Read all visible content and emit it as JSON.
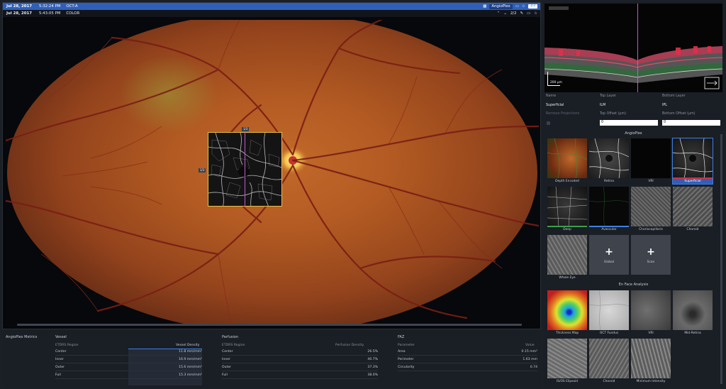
{
  "header_top": {
    "date": "Jul 28, 2017",
    "time": "5:32:24 PM",
    "modality": "OCT-A",
    "angioplex_label": "AngioPlex",
    "counter": "1/3"
  },
  "header_second": {
    "date": "Jul 28, 2017",
    "time": "5:43:05 PM",
    "mode": "COLOR",
    "page": "2/2"
  },
  "fundus": {
    "octa_tag_top": "1/3",
    "octa_tag_left": "1/3"
  },
  "metrics": {
    "section_title": "AngioPlex Metrics",
    "vessel": {
      "title": "Vessel",
      "col1": "ETDRS Region",
      "col2": "Vessel Density",
      "rows": [
        {
          "region": "Center",
          "value": "11.8 mm/mm²"
        },
        {
          "region": "Inner",
          "value": "16.9 mm/mm²"
        },
        {
          "region": "Outer",
          "value": "15.6 mm/mm²"
        },
        {
          "region": "Full",
          "value": "15.3 mm/mm²"
        }
      ]
    },
    "perfusion": {
      "title": "Perfusion",
      "col1": "ETDRS Region",
      "col2": "Perfusion Density",
      "rows": [
        {
          "region": "Center",
          "value": "26.5%"
        },
        {
          "region": "Inner",
          "value": "40.7%"
        },
        {
          "region": "Outer",
          "value": "37.3%"
        },
        {
          "region": "Full",
          "value": "38.0%"
        }
      ]
    },
    "faz": {
      "title": "FAZ",
      "col1": "Parameter",
      "col2": "Value",
      "rows": [
        {
          "region": "Area",
          "value": "0.15 mm²"
        },
        {
          "region": "Perimeter",
          "value": "1.63 mm"
        },
        {
          "region": "Circularity",
          "value": "0.74"
        }
      ]
    }
  },
  "bscan": {
    "scale_label": "200 µm"
  },
  "layers": {
    "name_label": "Name",
    "name_value": "Superficial",
    "top_label": "Top Layer",
    "top_value": "ILM",
    "bottom_label": "Bottom Layer",
    "bottom_value": "IPL",
    "remove_label": "Remove Projections",
    "top_offset_label": "Top Offset (µm)",
    "top_offset_value": "0",
    "bottom_offset_label": "Bottom Offset (µm)",
    "bottom_offset_value": "0"
  },
  "angioplex": {
    "title": "AngioPlex",
    "thumbs": [
      {
        "label": "Depth Encoded"
      },
      {
        "label": "Retina"
      },
      {
        "label": "VRI"
      },
      {
        "label": "Superficial"
      },
      {
        "label": "Deep"
      },
      {
        "label": "Avascular"
      },
      {
        "label": "Choriocapillaris"
      },
      {
        "label": "Choroid"
      },
      {
        "label": "Whole Eye"
      },
      {
        "label": "Global"
      },
      {
        "label": "Scan"
      }
    ]
  },
  "enface": {
    "title": "En Face Analysis",
    "thumbs": [
      {
        "label": "Thickness Map"
      },
      {
        "label": "OCT Fundus"
      },
      {
        "label": "VRI"
      },
      {
        "label": "Mid-Retina"
      },
      {
        "label": "IS/OS Elipsoid"
      },
      {
        "label": "Choroid"
      },
      {
        "label": "Minimum Intensity"
      }
    ]
  },
  "colors": {
    "header_blue": "#2f5fb8",
    "selection_blue": "#3d7fe0",
    "highlight_yellow": "#e3c24a",
    "marker_magenta": "#c25ad0"
  }
}
